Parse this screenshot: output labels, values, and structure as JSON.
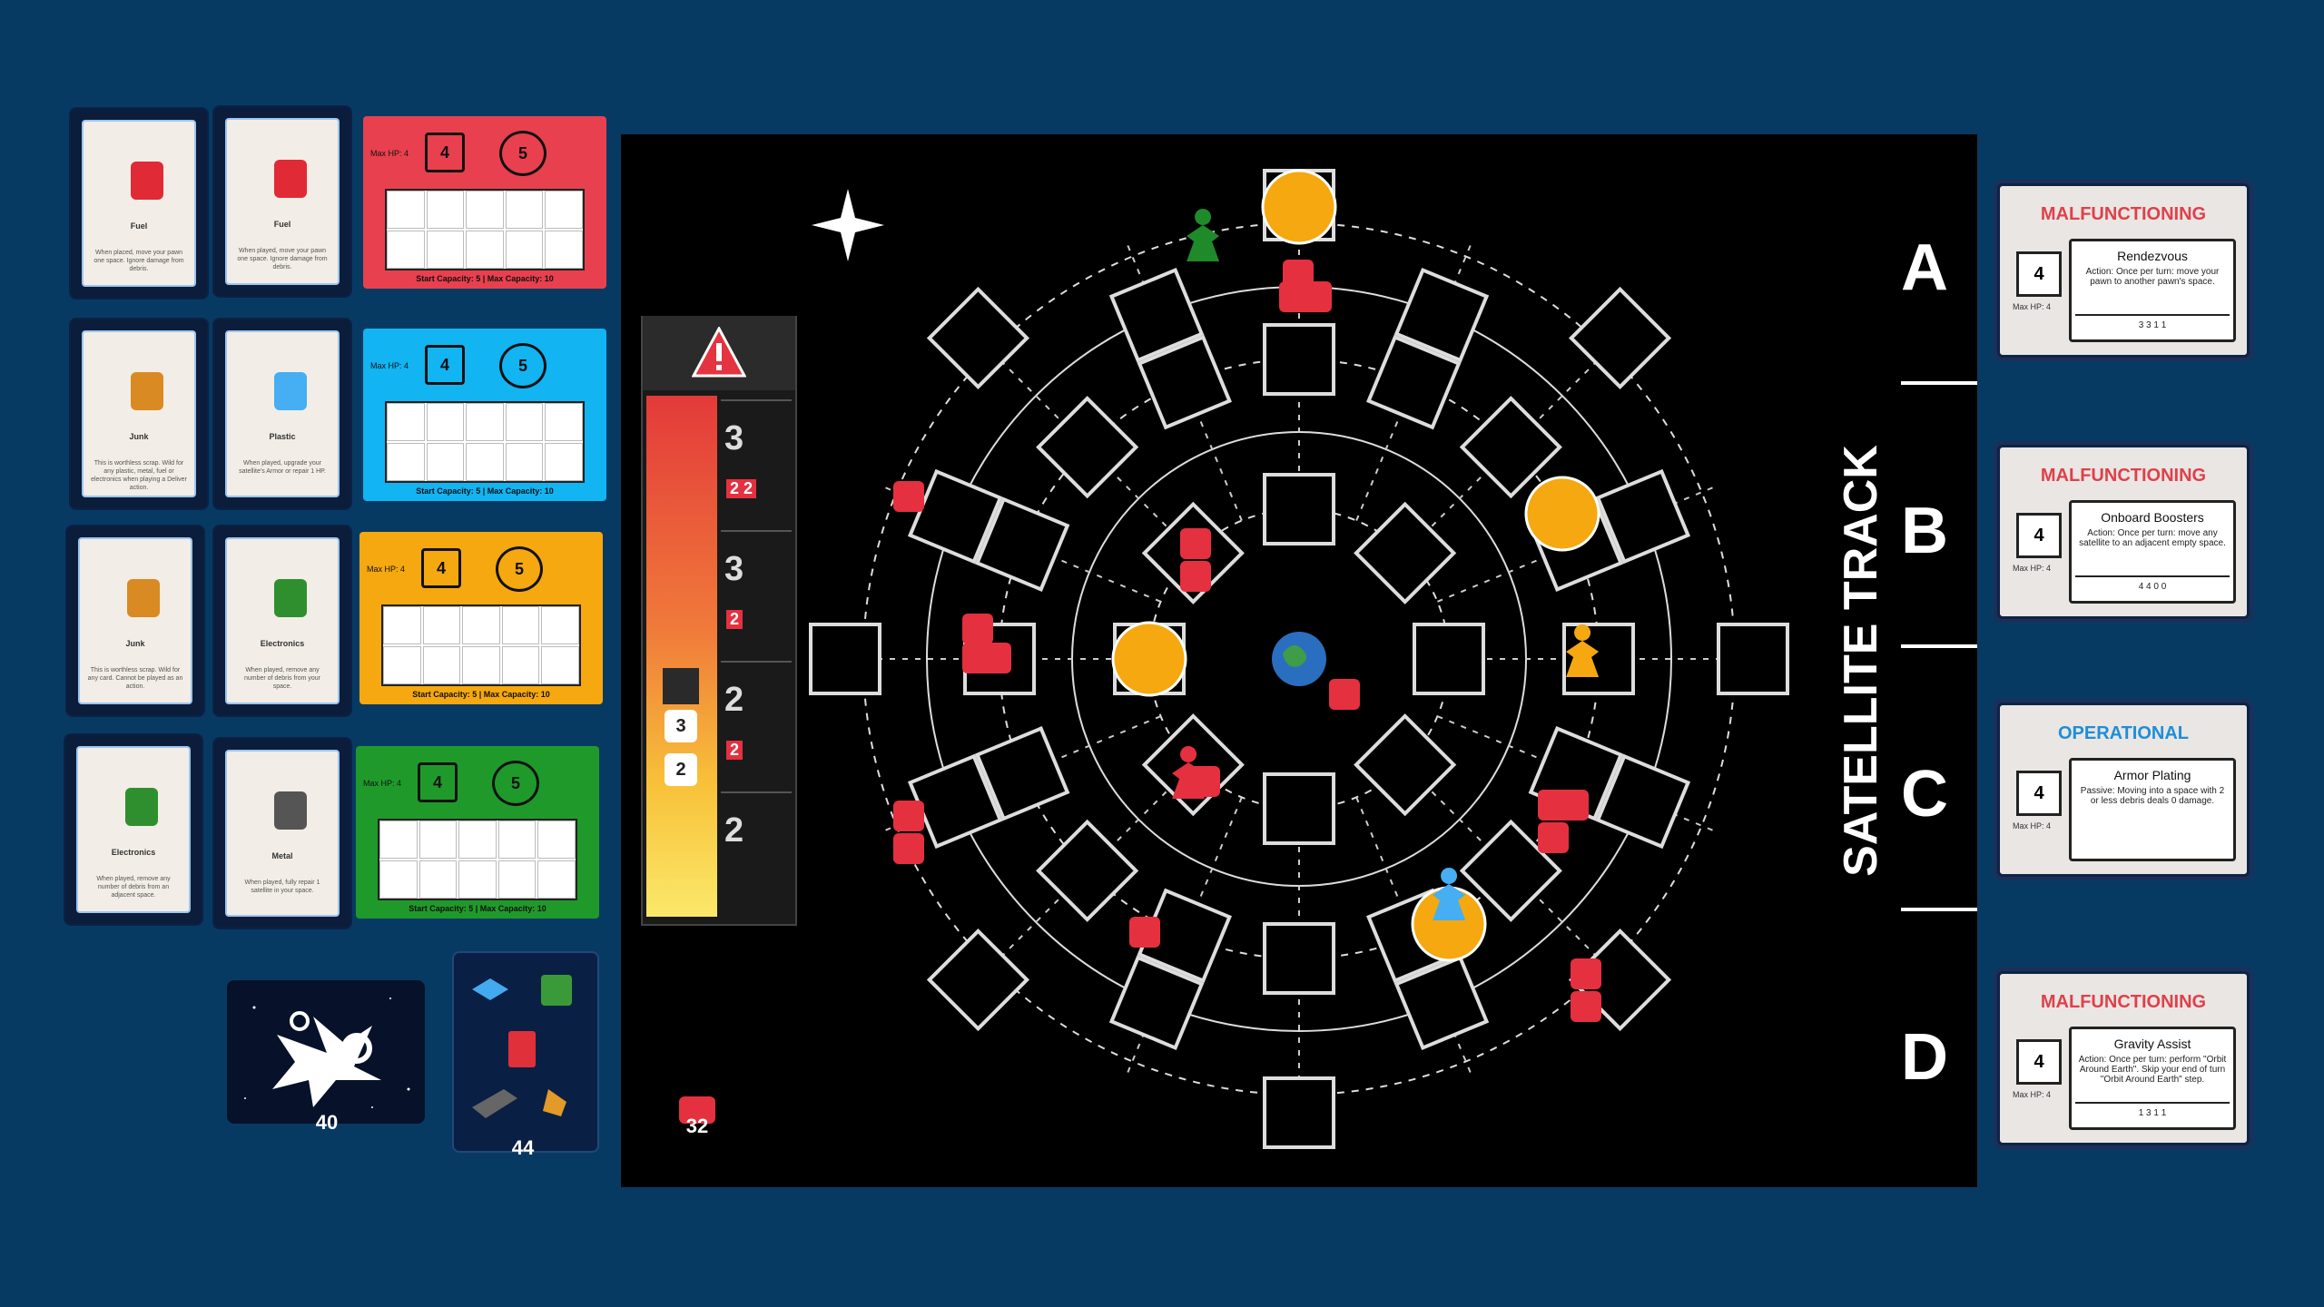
{
  "resource_cards": [
    {
      "title": "Fuel",
      "text": "When placed, move your pawn one space. Ignore damage from debris.",
      "icon": "fuel-can-icon"
    },
    {
      "title": "Fuel",
      "text": "When played, move your pawn one space. Ignore damage from debris.",
      "icon": "fuel-can-icon"
    },
    {
      "title": "Junk",
      "text": "This is worthless scrap. Wild for any plastic, metal, fuel or electronics when playing a Deliver action.",
      "icon": "junk-boot-icon"
    },
    {
      "title": "Plastic",
      "text": "When played, upgrade your satellite's Armor or repair 1 HP.",
      "icon": "plastic-cube-icon"
    },
    {
      "title": "Junk",
      "text": "This is worthless scrap. Wild for any card. Cannot be played as an action.",
      "icon": "junk-boot-icon"
    },
    {
      "title": "Electronics",
      "text": "When played, remove any number of debris from your space.",
      "icon": "chip-icon"
    },
    {
      "title": "Electronics",
      "text": "When played, remove any number of debris from an adjacent space.",
      "icon": "chip-icon"
    },
    {
      "title": "Metal",
      "text": "When played, fully repair 1 satellite in your space.",
      "icon": "metal-ingot-icon"
    }
  ],
  "player_boards": [
    {
      "color": "#e8404e",
      "max_hp": "Max HP: 4",
      "armor": "4",
      "shield": "5",
      "capacity": "Start Capacity: 5 | Max Capacity: 10"
    },
    {
      "color": "#12b4f2",
      "max_hp": "Max HP: 4",
      "armor": "4",
      "shield": "5",
      "capacity": "Start Capacity: 5 | Max Capacity: 10"
    },
    {
      "color": "#f5a80f",
      "max_hp": "Max HP: 4",
      "armor": "4",
      "shield": "5",
      "capacity": "Start Capacity: 5 | Max Capacity: 10"
    },
    {
      "color": "#1f9a2a",
      "max_hp": "Max HP: 4",
      "armor": "4",
      "shield": "5",
      "capacity": "Start Capacity: 5 | Max Capacity: 10"
    }
  ],
  "decks": {
    "debris_event_count": "40",
    "resource_count": "44"
  },
  "threat_track": {
    "rows": [
      {
        "num": "3",
        "debris": "2 2"
      },
      {
        "num": "3",
        "debris": "2"
      },
      {
        "num": "2",
        "debris": "2"
      },
      {
        "num": "2",
        "debris": ""
      }
    ],
    "markers": [
      "3",
      "2"
    ]
  },
  "debris_supply_count": "32",
  "satellite_track": {
    "label": "SATELLITE TRACK",
    "rows": [
      {
        "letter": "A",
        "status": "MALFUNCTIONING",
        "status_color": "#e0404a",
        "hp": "4",
        "hp_label": "Max HP: 4",
        "name": "Rendezvous",
        "desc": "Action: Once per turn: move your pawn to another pawn's space.",
        "cost": "3  3  1  1"
      },
      {
        "letter": "B",
        "status": "MALFUNCTIONING",
        "status_color": "#e0404a",
        "hp": "4",
        "hp_label": "Max HP: 4",
        "name": "Onboard Boosters",
        "desc": "Action: Once per turn: move any satellite to an adjacent empty space.",
        "cost": "4  4  0  0"
      },
      {
        "letter": "C",
        "status": "OPERATIONAL",
        "status_color": "#1e8ed8",
        "hp": "4",
        "hp_label": "Max HP: 4",
        "name": "Armor Plating",
        "desc": "Passive: Moving into a space with 2 or less debris deals 0 damage.",
        "cost": ""
      },
      {
        "letter": "D",
        "status": "MALFUNCTIONING",
        "status_color": "#e0404a",
        "hp": "4",
        "hp_label": "Max HP: 4",
        "name": "Gravity Assist",
        "desc": "Action: Once per turn: perform \"Orbit Around Earth\". Skip your end of turn \"Orbit Around Earth\" step.",
        "cost": "1  3  1  1"
      }
    ]
  },
  "satellites": [
    "A",
    "B",
    "C",
    "D"
  ]
}
